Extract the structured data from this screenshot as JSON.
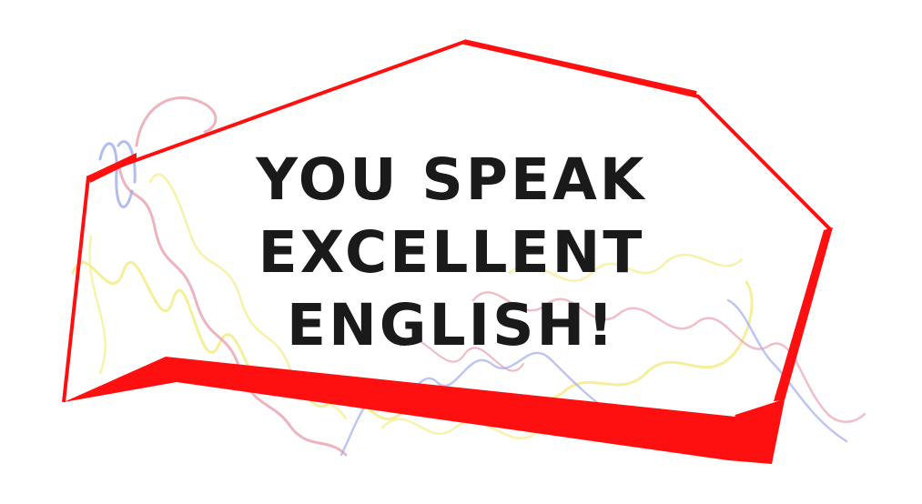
{
  "headline": {
    "lines": [
      "YOU SPEAK",
      "EXCELLENT",
      "ENGLISH!"
    ]
  },
  "colors": {
    "background": "#ffffff",
    "frame": "#ff1010",
    "text": "#1a1a1a",
    "scribble_pink": "#e8a0ae",
    "scribble_yellow": "#f3ec8a",
    "scribble_blue": "#9aa6e8"
  },
  "decorations": {
    "frame": "red-polygon-speech-bubble",
    "scribbles": [
      "pink-crayon-scribble",
      "yellow-crayon-scribble",
      "blue-crayon-scribble"
    ]
  }
}
